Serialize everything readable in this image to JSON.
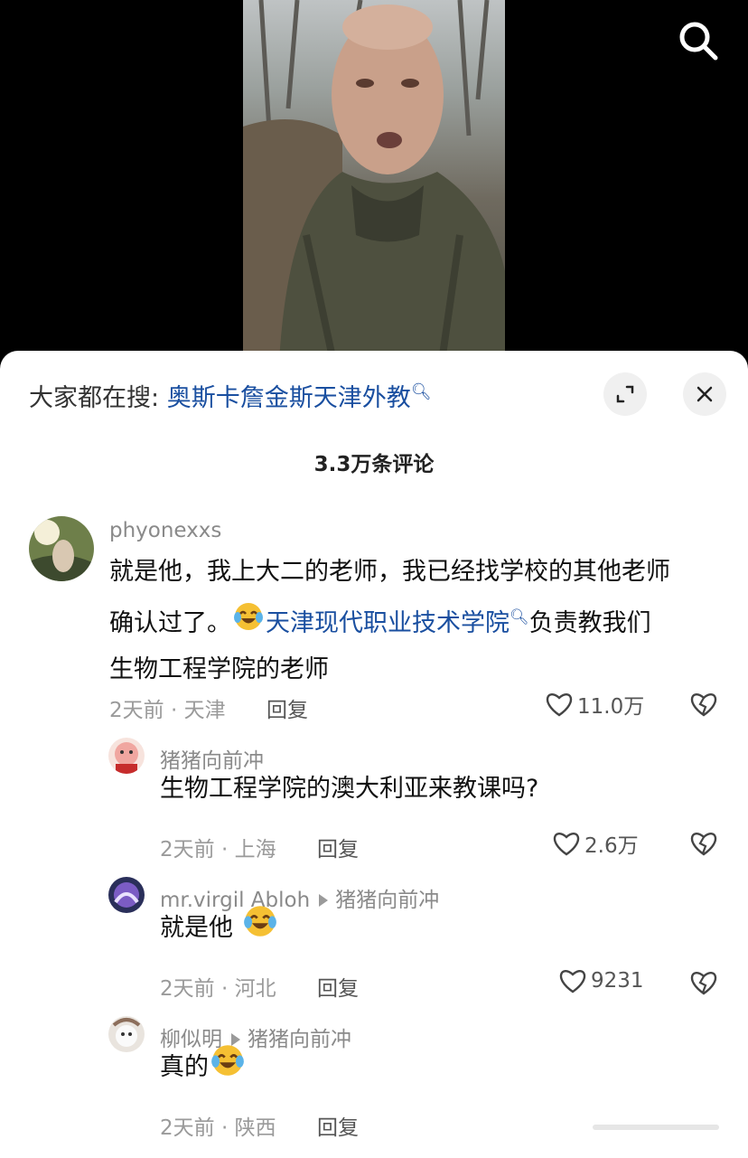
{
  "search_bar": {
    "prefix": "大家都在搜:",
    "term": "奥斯卡詹金斯天津外教",
    "q_icon": "search-icon"
  },
  "comment_count": "3.3万条评论",
  "comments": [
    {
      "username": "phyonexxs",
      "text_part1": "就是他，我上大二的老师，我已经找学校的其他老师",
      "text_part2": "确认过了。",
      "link": "天津现代职业技术学院",
      "text_part3": "负责教我们",
      "text_part4": "生物工程学院的老师",
      "meta": "2天前 · 天津",
      "reply": "回复",
      "likes": "11.0万"
    },
    {
      "username": "猪猪向前冲",
      "text": "生物工程学院的澳大利亚来教课吗?",
      "meta": "2天前 · 上海",
      "reply": "回复",
      "likes": "2.6万"
    },
    {
      "username": "mr.virgil Abloh",
      "reply_to": "猪猪向前冲",
      "text": "就是他",
      "meta": "2天前 · 河北",
      "reply": "回复",
      "likes": "9231"
    },
    {
      "username": "柳似明",
      "reply_to": "猪猪向前冲",
      "text": "真的",
      "meta": "2天前 · 陕西",
      "reply": "回复"
    }
  ],
  "colors": {
    "link": "#1a4fa0",
    "muted": "#9a9a9a",
    "sheet_bg": "#ffffff"
  }
}
